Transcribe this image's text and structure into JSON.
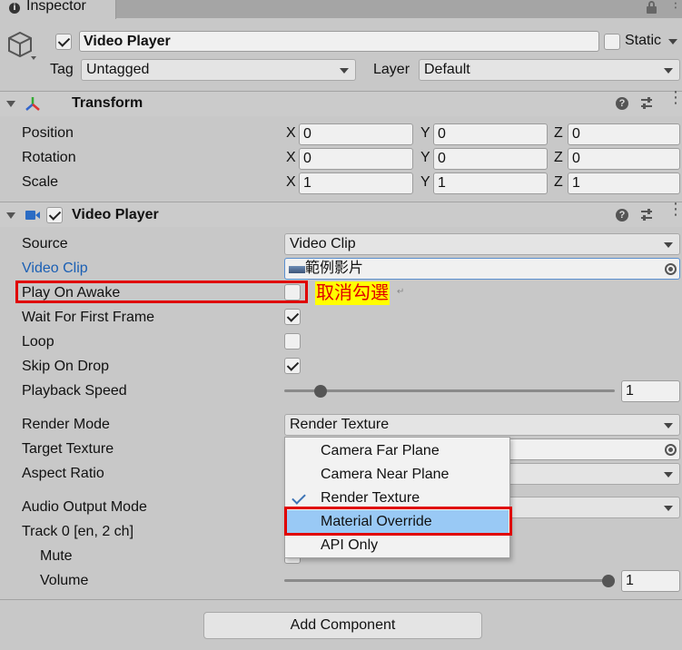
{
  "tab": {
    "title": "Inspector"
  },
  "object": {
    "name": "Video Player",
    "static_label": "Static",
    "tag_label": "Tag",
    "tag_value": "Untagged",
    "layer_label": "Layer",
    "layer_value": "Default"
  },
  "transform": {
    "title": "Transform",
    "rows": [
      {
        "label": "Position",
        "x": "0",
        "y": "0",
        "z": "0"
      },
      {
        "label": "Rotation",
        "x": "0",
        "y": "0",
        "z": "0"
      },
      {
        "label": "Scale",
        "x": "1",
        "y": "1",
        "z": "1"
      }
    ],
    "axis_x": "X",
    "axis_y": "Y",
    "axis_z": "Z"
  },
  "video_player": {
    "title": "Video Player",
    "source_label": "Source",
    "source_value": "Video Clip",
    "video_clip_label": "Video Clip",
    "video_clip_value": "範例影片",
    "play_on_awake_label": "Play On Awake",
    "play_on_awake": false,
    "wait_first_frame_label": "Wait For First Frame",
    "wait_first_frame": true,
    "loop_label": "Loop",
    "loop": false,
    "skip_on_drop_label": "Skip On Drop",
    "skip_on_drop": true,
    "playback_speed_label": "Playback Speed",
    "playback_speed_value": "1",
    "playback_speed_fraction": 0.11,
    "render_mode_label": "Render Mode",
    "render_mode_value": "Render Texture",
    "target_texture_label": "Target Texture",
    "aspect_ratio_label": "Aspect Ratio",
    "audio_output_label": "Audio Output Mode",
    "track_label": "Track 0 [en, 2 ch]",
    "mute_label": "Mute",
    "volume_label": "Volume",
    "volume_value": "1",
    "volume_fraction": 1.0
  },
  "annotation": {
    "text": "取消勾選",
    "return_mark": "↵"
  },
  "render_menu": {
    "items": [
      "Camera Far Plane",
      "Camera Near Plane",
      "Render Texture",
      "Material Override",
      "API Only"
    ],
    "selected_index": 2,
    "highlighted_index": 3
  },
  "add_component": {
    "label": "Add Component"
  },
  "colors": {
    "link_blue": "#1a5fb4",
    "highlight": "#99c9f5",
    "annotation_bg": "#ffff00",
    "annotation_text": "#e00000",
    "red_box": "#e00000"
  }
}
